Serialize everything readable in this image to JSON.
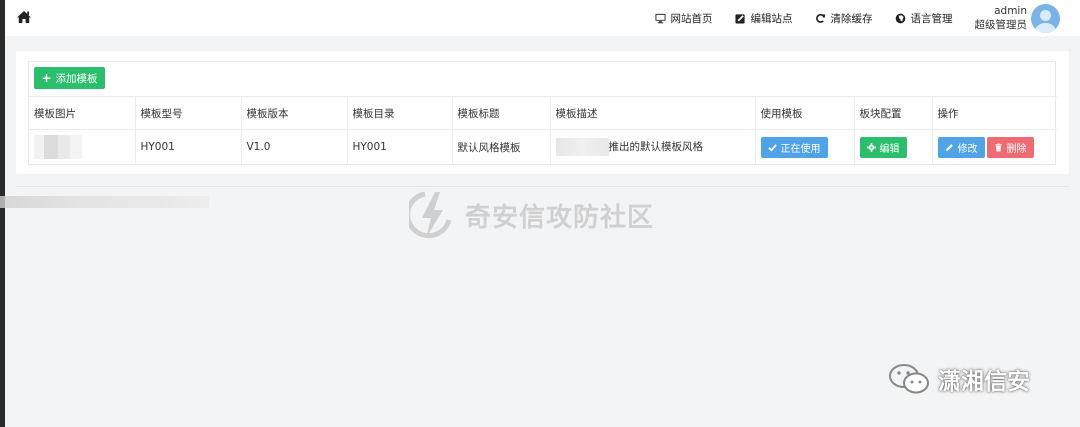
{
  "topbar": {
    "nav": [
      {
        "label": "网站首页",
        "icon": "monitor-icon"
      },
      {
        "label": "编辑站点",
        "icon": "edit-icon"
      },
      {
        "label": "清除缓存",
        "icon": "refresh-icon"
      },
      {
        "label": "语言管理",
        "icon": "globe-icon"
      }
    ],
    "user": {
      "name": "admin",
      "role": "超级管理员"
    }
  },
  "toolbar": {
    "add_label": "添加模板"
  },
  "table": {
    "headers": [
      "模板图片",
      "模板型号",
      "模板版本",
      "模板目录",
      "模板标题",
      "模板描述",
      "使用模板",
      "板块配置",
      "操作"
    ],
    "rows": [
      {
        "model": "HY001",
        "version": "V1.0",
        "directory": "HY001",
        "title": "默认风格模板",
        "description": "推出的默认模板风格",
        "use_label": "正在使用",
        "config_label": "编辑",
        "edit_label": "修改",
        "delete_label": "删除"
      }
    ]
  },
  "watermarks": {
    "center": "奇安信攻防社区",
    "bottom_right": "潇湘信安"
  },
  "colors": {
    "green": "#2bbf6d",
    "blue": "#4fa3e6",
    "red": "#ef6b74"
  }
}
